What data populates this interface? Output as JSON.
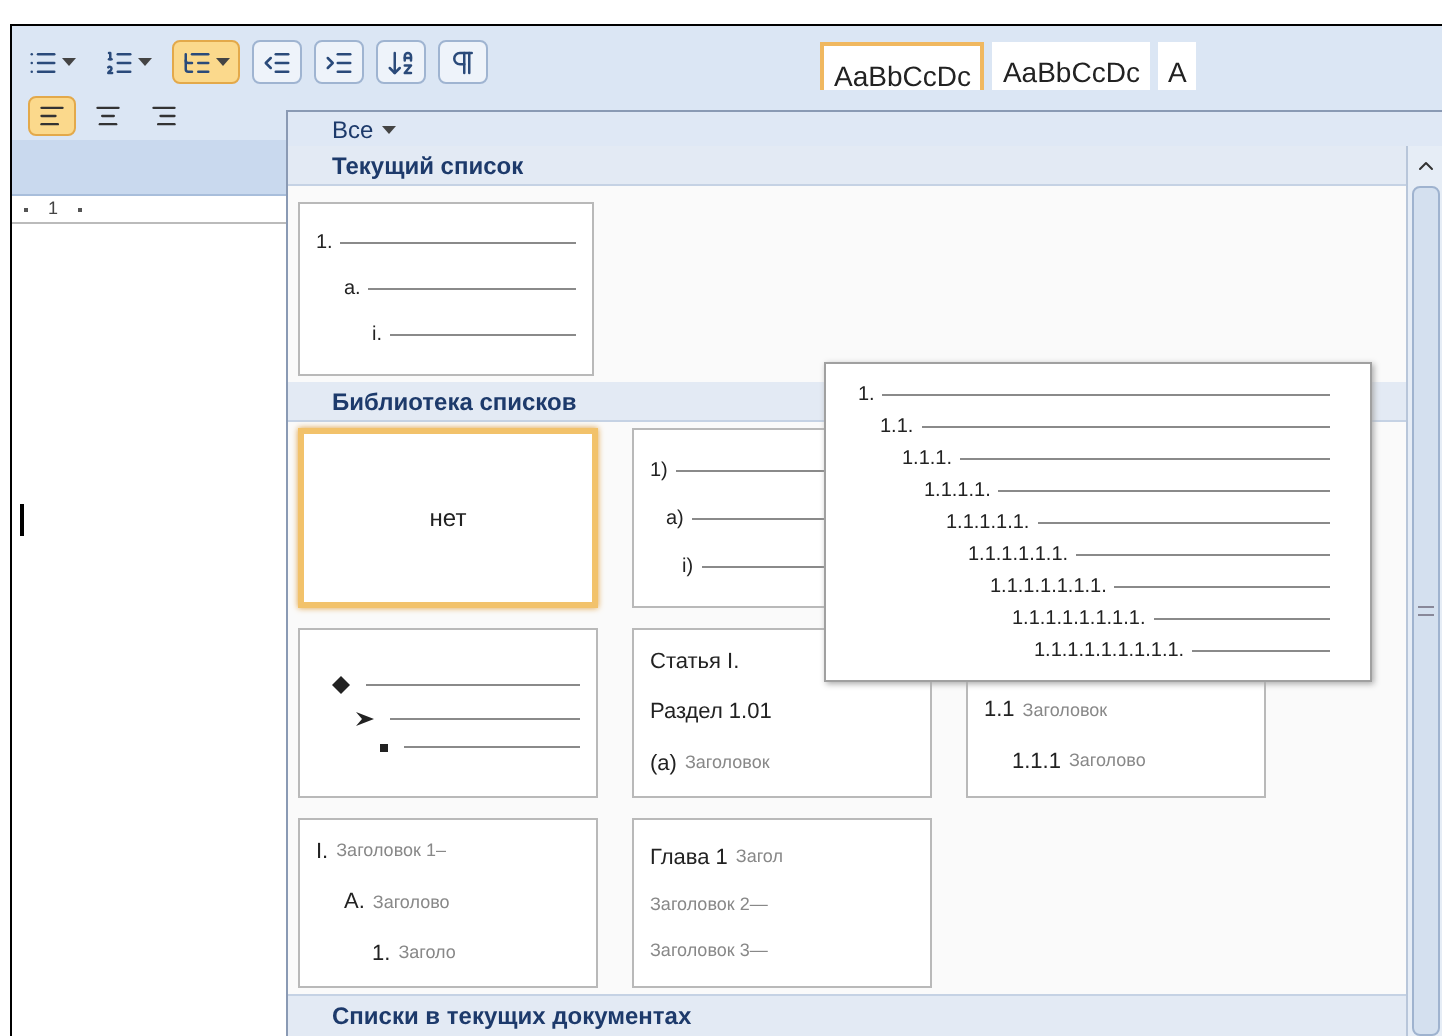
{
  "toolbar": {
    "list_buttons": [
      {
        "kind": "bullets",
        "selected": false
      },
      {
        "kind": "numbering",
        "selected": false
      },
      {
        "kind": "multilevel",
        "selected": true
      },
      {
        "kind": "outdent",
        "selected": false
      },
      {
        "kind": "indent",
        "selected": false
      },
      {
        "kind": "sort",
        "selected": false
      },
      {
        "kind": "pilcrow",
        "selected": false
      }
    ],
    "align_buttons": [
      {
        "kind": "left",
        "selected": true
      },
      {
        "kind": "center",
        "selected": false
      },
      {
        "kind": "right",
        "selected": false
      }
    ],
    "styles_gallery": [
      {
        "label": "AaBbCcDc",
        "selected": true
      },
      {
        "label": "AaBbCcDc",
        "selected": false
      },
      {
        "label": "A",
        "selected": false
      }
    ]
  },
  "ruler": {
    "label": "1"
  },
  "dropdown": {
    "filter": "Все",
    "current_section": {
      "title": "Текущий список",
      "tile": {
        "lines": [
          {
            "number": "1."
          },
          {
            "number": "a."
          },
          {
            "number": "i."
          }
        ]
      }
    },
    "library_section": {
      "title": "Библиотека списков",
      "rows": [
        [
          {
            "kind": "none",
            "label": "нет",
            "selected": true
          },
          {
            "kind": "levels",
            "selected": false,
            "lines": [
              {
                "number": "1)"
              },
              {
                "number": "a)"
              },
              {
                "number": "i)"
              }
            ]
          }
        ],
        [
          {
            "kind": "bullets",
            "selected": false,
            "lines": [
              {
                "kind": "diamond"
              },
              {
                "kind": "arrow"
              },
              {
                "kind": "square"
              }
            ]
          },
          {
            "kind": "headings",
            "selected": false,
            "lines": [
              {
                "number": "Статья I."
              },
              {
                "number": "Раздел 1.01"
              },
              {
                "number": "(a)",
                "caption": "Заголовок"
              }
            ]
          },
          {
            "kind": "headings",
            "selected": false,
            "lines": [
              {
                "number": "1.1",
                "caption": "Заголовок"
              },
              {
                "number": "1.1.1",
                "caption": "Заголово"
              }
            ]
          }
        ],
        [
          {
            "kind": "headings",
            "selected": false,
            "lines": [
              {
                "number": "I.",
                "caption": "Заголовок 1–"
              },
              {
                "number": "A.",
                "caption": "Заголово"
              },
              {
                "number": "1.",
                "caption": "Заголо"
              }
            ]
          },
          {
            "kind": "headings",
            "selected": false,
            "lines": [
              {
                "number": "Глава 1",
                "caption": "Загол"
              },
              {
                "caption": "Заголовок 2—"
              },
              {
                "caption": "Заголовок 3—"
              }
            ]
          }
        ]
      ]
    },
    "documents_section": {
      "title": "Списки в текущих документах"
    },
    "preview": {
      "lines": [
        "1.",
        "1.1.",
        "1.1.1.",
        "1.1.1.1.",
        "1.1.1.1.1.",
        "1.1.1.1.1.1.",
        "1.1.1.1.1.1.1.",
        "1.1.1.1.1.1.1.1.",
        "1.1.1.1.1.1.1.1.1."
      ]
    }
  }
}
